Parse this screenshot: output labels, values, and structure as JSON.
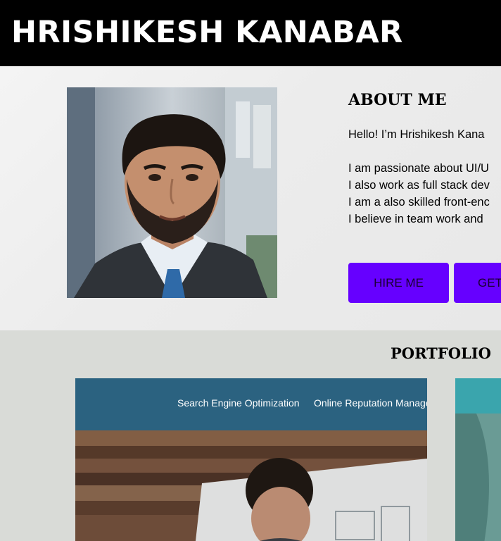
{
  "header": {
    "name": "HRISHIKESH KANABAR"
  },
  "about": {
    "title": "ABOUT ME",
    "greeting": "Hello! I’m Hrishikesh Kana",
    "lines": [
      "I am passionate about UI/U",
      "I also work as full stack dev",
      "I am a also skilled front-enc",
      "I believe in team work and"
    ],
    "buttons": {
      "hire": "HIRE ME",
      "touch": "GET"
    }
  },
  "portfolio": {
    "title": "PORTFOLIO",
    "card1": {
      "nav": [
        "Search Engine Optimization",
        "Online Reputation Manage"
      ]
    }
  },
  "colors": {
    "header_bg": "#000000",
    "accent": "#6600ff",
    "portfolio_bg": "#d9dbd7"
  }
}
